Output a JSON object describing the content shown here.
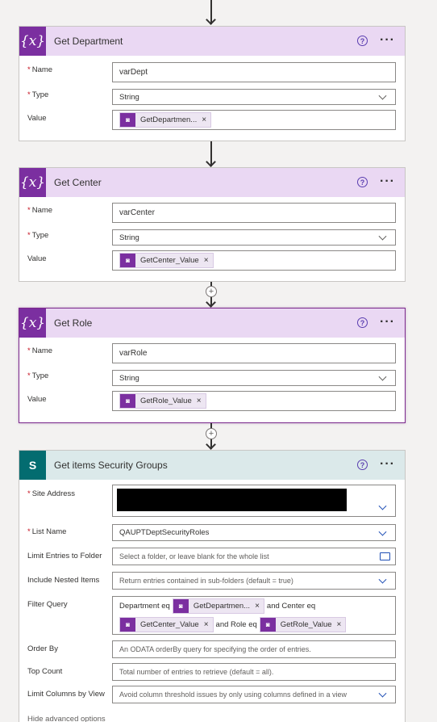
{
  "cards": [
    {
      "title": "Get Department",
      "name_label": "Name",
      "name_value": "varDept",
      "type_label": "Type",
      "type_value": "String",
      "value_label": "Value",
      "token": "GetDepartmen..."
    },
    {
      "title": "Get Center",
      "name_label": "Name",
      "name_value": "varCenter",
      "type_label": "Type",
      "type_value": "String",
      "value_label": "Value",
      "token": "GetCenter_Value"
    },
    {
      "title": "Get Role",
      "name_label": "Name",
      "name_value": "varRole",
      "type_label": "Type",
      "type_value": "String",
      "value_label": "Value",
      "token": "GetRole_Value"
    }
  ],
  "sp": {
    "title": "Get items Security Groups",
    "site_label": "Site Address",
    "list_label": "List Name",
    "list_value": "QAUPTDeptSecurityRoles",
    "limit_label": "Limit Entries to Folder",
    "limit_ph": "Select a folder, or leave blank for the whole list",
    "nested_label": "Include Nested Items",
    "nested_ph": "Return entries contained in sub-folders (default = true)",
    "filter_label": "Filter Query",
    "filter_t1": "Department eq",
    "filter_tok1": "GetDepartmen...",
    "filter_t2": "and Center eq",
    "filter_tok2": "GetCenter_Value",
    "filter_t3": "and Role eq",
    "filter_tok3": "GetRole_Value",
    "order_label": "Order By",
    "order_ph": "An ODATA orderBy query for specifying the order of entries.",
    "top_label": "Top Count",
    "top_ph": "Total number of entries to retrieve (default = all).",
    "cols_label": "Limit Columns by View",
    "cols_ph": "Avoid column threshold issues by only using columns defined in a view",
    "advanced": "Hide advanced options"
  },
  "icons": {
    "variable": "variable-icon",
    "sharepoint": "sharepoint-icon",
    "help": "help-icon",
    "more": "more-icon",
    "token": "power-apps-token-icon",
    "remove": "remove-x-icon"
  },
  "colors": {
    "variable_header": "#ead8f3",
    "variable_icon": "#7b2fa0",
    "sp_header": "#dbe9ea",
    "sp_icon": "#036c70",
    "required": "#c50f1f"
  }
}
